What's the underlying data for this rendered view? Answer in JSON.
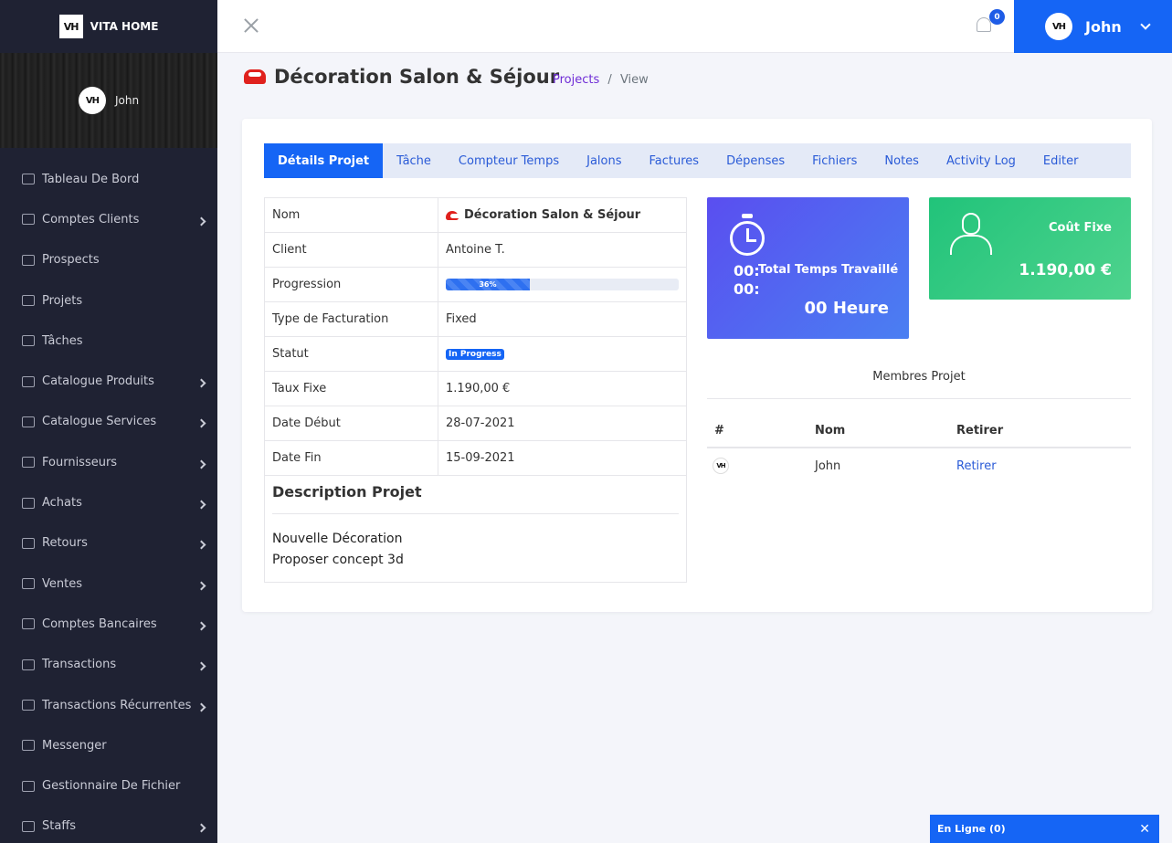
{
  "brand": {
    "logo": "VH",
    "name": "VITA HOME"
  },
  "profile": {
    "initials": "VH",
    "name": "John"
  },
  "sidebar": {
    "items": [
      {
        "label": "Tableau De Bord",
        "icon": "dashboard-icon",
        "has_children": false
      },
      {
        "label": "Comptes Clients",
        "icon": "id-card-icon",
        "has_children": true
      },
      {
        "label": "Prospects",
        "icon": "phone-icon",
        "has_children": false
      },
      {
        "label": "Projets",
        "icon": "briefcase-icon",
        "has_children": false
      },
      {
        "label": "Tâches",
        "icon": "checkbox-icon",
        "has_children": false
      },
      {
        "label": "Catalogue Produits",
        "icon": "cart-icon",
        "has_children": true
      },
      {
        "label": "Catalogue Services",
        "icon": "book-icon",
        "has_children": true
      },
      {
        "label": "Fournisseurs",
        "icon": "truck-icon",
        "has_children": true
      },
      {
        "label": "Achats",
        "icon": "bag-icon",
        "has_children": true
      },
      {
        "label": "Retours",
        "icon": "return-icon",
        "has_children": true
      },
      {
        "label": "Ventes",
        "icon": "shopping-cart-icon",
        "has_children": true
      },
      {
        "label": "Comptes Bancaires",
        "icon": "credit-card-icon",
        "has_children": true
      },
      {
        "label": "Transactions",
        "icon": "receipt-icon",
        "has_children": true
      },
      {
        "label": "Transactions Récurrentes",
        "icon": "wallet-icon",
        "has_children": true
      },
      {
        "label": "Messenger",
        "icon": "chat-icon",
        "has_children": false
      },
      {
        "label": "Gestionnaire De Fichier",
        "icon": "folder-icon",
        "has_children": false
      },
      {
        "label": "Staffs",
        "icon": "user-icon",
        "has_children": true
      }
    ]
  },
  "topbar": {
    "notification_count": "0",
    "user_initials": "VH",
    "user_name": "John"
  },
  "page": {
    "title": "Décoration Salon & Séjour"
  },
  "breadcrumb": {
    "link": "Projects",
    "separator": "/",
    "current": "View"
  },
  "tabs": [
    {
      "label": "Détails Projet",
      "active": true
    },
    {
      "label": "Tâche"
    },
    {
      "label": "Compteur Temps"
    },
    {
      "label": "Jalons"
    },
    {
      "label": "Factures"
    },
    {
      "label": "Dépenses"
    },
    {
      "label": "Fichiers"
    },
    {
      "label": "Notes"
    },
    {
      "label": "Activity Log"
    },
    {
      "label": "Editer"
    }
  ],
  "details": {
    "nom_label": "Nom",
    "nom_value": "Décoration Salon & Séjour",
    "client_label": "Client",
    "client_value": "Antoine T.",
    "progress_label": "Progression",
    "progress_value": "36%",
    "progress_fraction": 0.36,
    "billing_label": "Type de Facturation",
    "billing_value": "Fixed",
    "status_label": "Statut",
    "status_value": "In Progress",
    "rate_label": "Taux Fixe",
    "rate_value": "1.190,00 €",
    "start_label": "Date Début",
    "start_value": "28-07-2021",
    "end_label": "Date Fin",
    "end_value": "15-09-2021"
  },
  "description": {
    "title": "Description Projet",
    "line1": "Nouvelle Décoration",
    "line2": "Proposer concept 3d"
  },
  "time_tile": {
    "line1": "00:",
    "line2": "00:",
    "label": "Total Temps Travaillé",
    "hours": "00 Heure"
  },
  "cost_tile": {
    "label": "Coût Fixe",
    "value": "1.190,00 €"
  },
  "members": {
    "title": "Membres Projet",
    "headers": {
      "num": "#",
      "name": "Nom",
      "remove": "Retirer"
    },
    "rows": [
      {
        "avatar": "VH",
        "name": "John",
        "action": "Retirer"
      }
    ]
  },
  "online": {
    "label": "En Ligne (0)",
    "close": "✕"
  },
  "colors": {
    "primary": "#1565f5",
    "sidebar": "#1f2233",
    "tile_blue": "#5a4ef0",
    "tile_green": "#21c37a"
  }
}
